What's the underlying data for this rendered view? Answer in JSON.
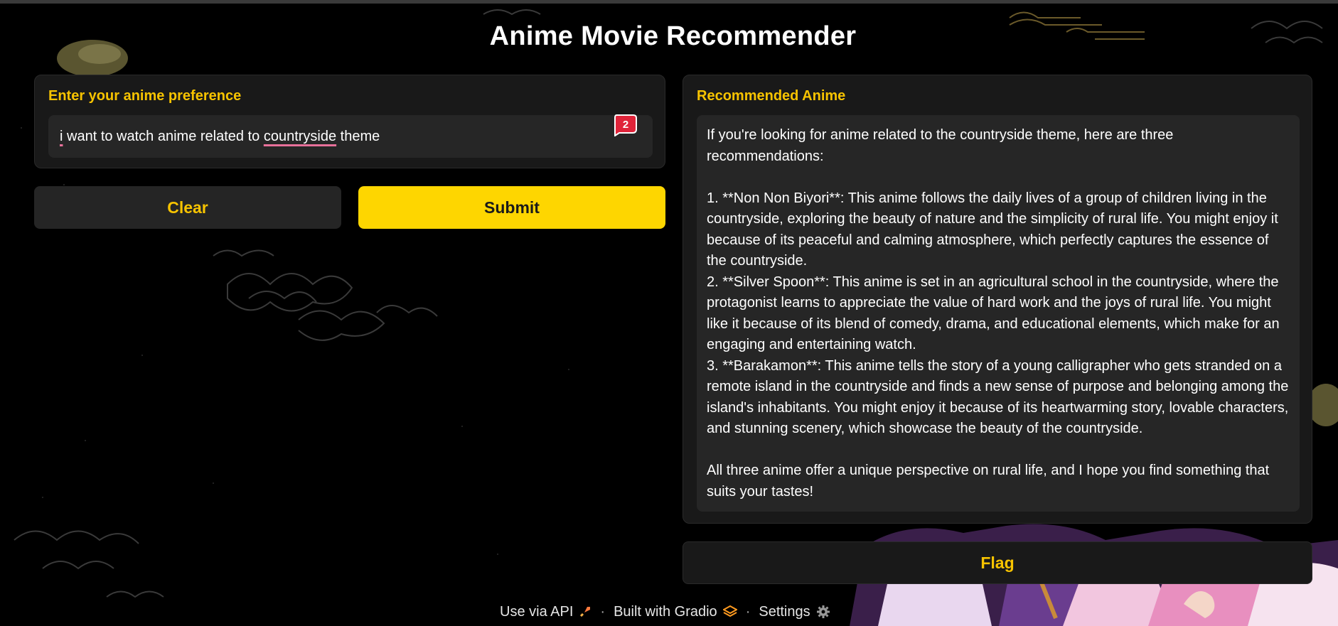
{
  "app": {
    "title": "Anime Movie Recommender"
  },
  "input": {
    "label": "Enter your anime preference",
    "value_parts": [
      "i",
      " want to watch anime related to ",
      "countryside",
      " theme"
    ],
    "notification_count": "2"
  },
  "buttons": {
    "clear": "Clear",
    "submit": "Submit",
    "flag": "Flag"
  },
  "output": {
    "label": "Recommended Anime",
    "text": "If you're looking for anime related to the countryside theme, here are three recommendations:\n\n1. **Non Non Biyori**: This anime follows the daily lives of a group of children living in the countryside, exploring the beauty of nature and the simplicity of rural life. You might enjoy it because of its peaceful and calming atmosphere, which perfectly captures the essence of the countryside.\n2. **Silver Spoon**: This anime is set in an agricultural school in the countryside, where the protagonist learns to appreciate the value of hard work and the joys of rural life. You might like it because of its blend of comedy, drama, and educational elements, which make for an engaging and entertaining watch.\n3. **Barakamon**: This anime tells the story of a young calligrapher who gets stranded on a remote island in the countryside and finds a new sense of purpose and belonging among the island's inhabitants. You might enjoy it because of its heartwarming story, lovable characters, and stunning scenery, which showcase the beauty of the countryside.\n\nAll three anime offer a unique perspective on rural life, and I hope you find something that suits your tastes!"
  },
  "footer": {
    "api": "Use via API",
    "separator": "·",
    "built": "Built with Gradio",
    "settings": "Settings"
  },
  "colors": {
    "accent": "#f7c300",
    "submit_bg": "#fed600",
    "panel": "#191919",
    "field": "#262626",
    "background": "#000000"
  },
  "icons": {
    "api": "rocket-icon",
    "gradio": "gradio-logo-icon",
    "settings": "gear-icon",
    "badge": "notification-badge-icon"
  }
}
